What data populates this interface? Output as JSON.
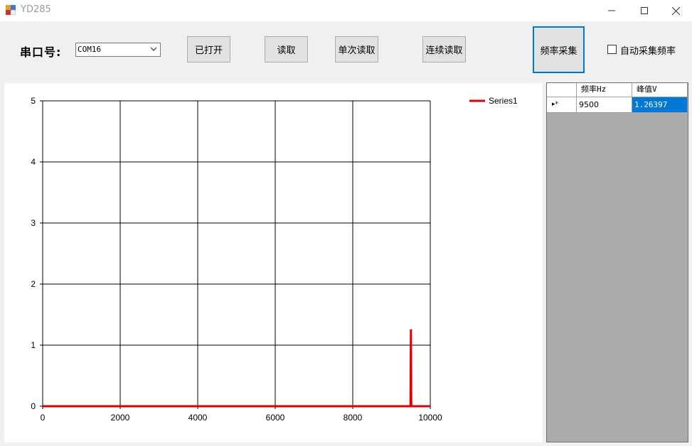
{
  "window": {
    "title": "YD285",
    "minimize": "—",
    "maximize": "☐",
    "close": "✕"
  },
  "toolbar": {
    "port_label": "串口号:",
    "port_value": "COM16",
    "open_button": "已打开",
    "read_button": "读取",
    "single_read_button": "单次读取",
    "continuous_read_button": "连续读取",
    "freq_collect_button": "频率采集",
    "auto_collect_checked": false,
    "auto_collect_label": "自动采集频率"
  },
  "grid": {
    "columns": [
      "频率Hz",
      "峰值V"
    ],
    "rows": [
      {
        "indicator": "▸*",
        "freq": "9500",
        "peak": "1.26397"
      }
    ]
  },
  "chart_data": {
    "type": "line",
    "xlim": [
      0,
      10000
    ],
    "ylim": [
      0,
      5
    ],
    "x_ticks": [
      "0",
      "2000",
      "4000",
      "6000",
      "8000",
      "10000"
    ],
    "y_ticks": [
      "0",
      "1",
      "2",
      "3",
      "4",
      "5"
    ],
    "grid": true,
    "legend": "top-right",
    "series": [
      {
        "name": "Series1",
        "color": "#e00000",
        "points": [
          [
            0,
            0.0
          ],
          [
            9450,
            0.0
          ],
          [
            9490,
            0.0
          ],
          [
            9500,
            1.26
          ],
          [
            9510,
            0.0
          ],
          [
            9560,
            0.0
          ],
          [
            10000,
            0.0
          ]
        ]
      }
    ]
  }
}
